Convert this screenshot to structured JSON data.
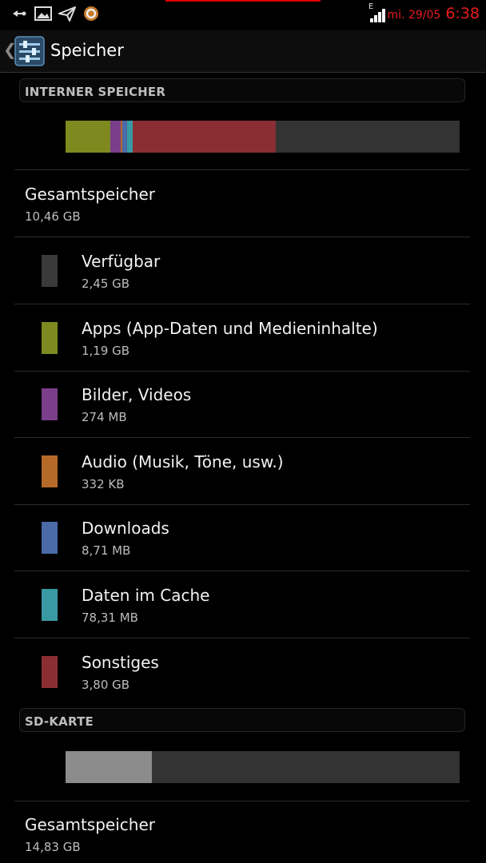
{
  "status_bar": {
    "date": "mi. 29/05",
    "time": "6:38",
    "network": "E"
  },
  "header": {
    "title": "Speicher"
  },
  "internal": {
    "section_label": "INTERNER SPEICHER",
    "bar": [
      {
        "name": "Apps",
        "fraction": 0.114,
        "color": "#7e8a1f"
      },
      {
        "name": "Bilder, Videos",
        "fraction": 0.026,
        "color": "#7a3e8a"
      },
      {
        "name": "Audio",
        "fraction": 0.004,
        "color": "#b56a2a"
      },
      {
        "name": "Downloads",
        "fraction": 0.012,
        "color": "#4a6aa8"
      },
      {
        "name": "Daten im Cache",
        "fraction": 0.014,
        "color": "#3a9aa4"
      },
      {
        "name": "Sonstiges",
        "fraction": 0.363,
        "color": "#8a2e33"
      }
    ],
    "total_label": "Gesamtspeicher",
    "total_value": "10,46 GB",
    "items": [
      {
        "label": "Verfügbar",
        "value": "2,45 GB",
        "color": "#3a3a3a"
      },
      {
        "label": "Apps (App-Daten und Medieninhalte)",
        "value": "1,19 GB",
        "color": "#7e8a1f"
      },
      {
        "label": "Bilder, Videos",
        "value": "274 MB",
        "color": "#7a3e8a"
      },
      {
        "label": "Audio (Musik, Töne, usw.)",
        "value": "332 KB",
        "color": "#b56a2a"
      },
      {
        "label": "Downloads",
        "value": "8,71 MB",
        "color": "#4a6aa8"
      },
      {
        "label": "Daten im Cache",
        "value": "78,31 MB",
        "color": "#3a9aa4"
      },
      {
        "label": "Sonstiges",
        "value": "3,80 GB",
        "color": "#8a2e33"
      }
    ]
  },
  "sd": {
    "section_label": "SD-KARTE",
    "bar_used_fraction": 0.22,
    "bar_used_color": "#8c8c8c",
    "total_label": "Gesamtspeicher",
    "total_value": "14,83 GB"
  }
}
